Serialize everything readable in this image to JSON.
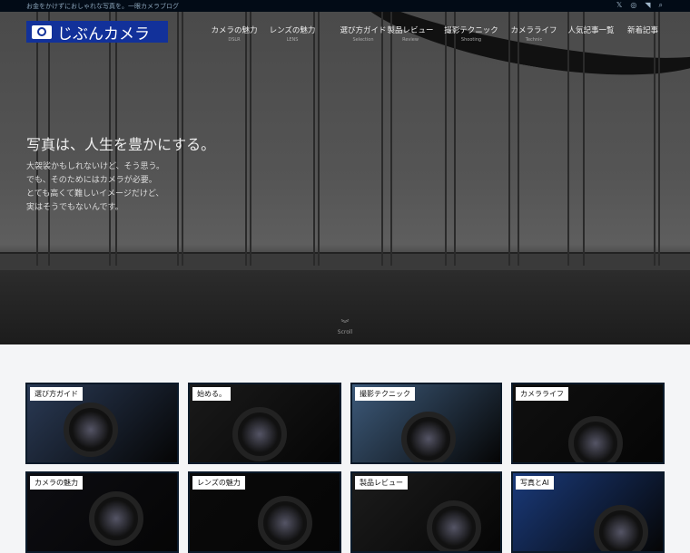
{
  "topbar": {
    "tagline": "お金をかけずにおしゃれな写真を。一眼カメラブログ",
    "icons": [
      "x-icon",
      "instagram-icon",
      "rss-icon",
      "search-icon"
    ]
  },
  "logo": {
    "text": "じぶんカメラ"
  },
  "nav": [
    {
      "label": "カメラの魅力",
      "sub": "DSLR"
    },
    {
      "label": "レンズの魅力",
      "sub": "LENS"
    },
    {
      "label": "選び方ガイド",
      "sub": "Selection"
    },
    {
      "label": "製品レビュー",
      "sub": "Review"
    },
    {
      "label": "撮影テクニック",
      "sub": "Shooting"
    },
    {
      "label": "カメラライフ",
      "sub": "Technic"
    },
    {
      "label": "人気記事一覧",
      "sub": ""
    },
    {
      "label": "新着記事",
      "sub": ""
    }
  ],
  "hero": {
    "title": "写真は、人生を豊かにする。",
    "lines": [
      "大袈裟かもしれないけど、そう思う。",
      "でも、そのためにはカメラが必要。",
      "とても高くて難しいイメージだけど、",
      "実はそうでもないんです。"
    ],
    "scroll": "Scroll"
  },
  "cards": [
    {
      "label": "選び方ガイド",
      "bg": "#2a3a55"
    },
    {
      "label": "始める。",
      "bg": "#1a1a1a"
    },
    {
      "label": "撮影テクニック",
      "bg": "#3d5a7a"
    },
    {
      "label": "カメラライフ",
      "bg": "#101010"
    },
    {
      "label": "カメラの魅力",
      "bg": "#0d0d12"
    },
    {
      "label": "レンズの魅力",
      "bg": "#0a0a0a"
    },
    {
      "label": "製品レビュー",
      "bg": "#1c1c1c"
    },
    {
      "label": "写真とAI",
      "bg": "#1a3a7a"
    }
  ]
}
